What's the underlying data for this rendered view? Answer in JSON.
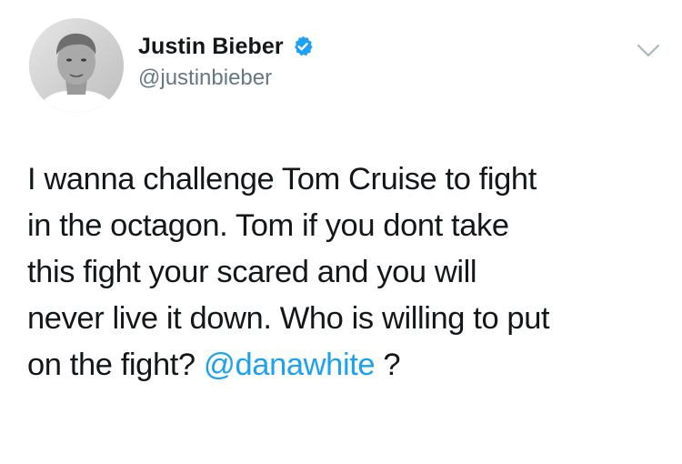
{
  "tweet": {
    "author": {
      "display_name": "Justin Bieber",
      "handle": "@justinbieber",
      "verified": true
    },
    "text_lines": [
      "I wanna challenge Tom Cruise to fight",
      "in the octagon. Tom if you dont take",
      "this fight your scared and you will",
      "never live it down. Who is willing to put"
    ],
    "last_line": {
      "before_mention": "on the fight? ",
      "mention": "@danawhite",
      "after_mention": " ?"
    }
  },
  "icons": {
    "avatar": "profile-photo",
    "verified": "verified-badge-icon",
    "menu": "chevron-down-icon"
  },
  "colors": {
    "text": "#14171a",
    "secondary_text": "#657786",
    "link": "#1da1f2",
    "verified_badge": "#1da1f2",
    "chevron": "#aab8c2"
  }
}
